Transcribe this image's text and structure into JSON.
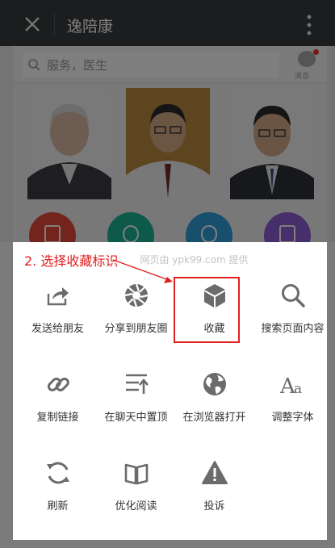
{
  "topbar": {
    "title": "逸陪康"
  },
  "search": {
    "placeholder": "服务，医生",
    "msg_label": "消息"
  },
  "share_sheet": {
    "provided_by": "网页由 ypk99.com 提供",
    "rows": [
      [
        {
          "label": "发送给朋友",
          "icon": "share-icon"
        },
        {
          "label": "分享到朋友圈",
          "icon": "aperture-icon"
        },
        {
          "label": "收藏",
          "icon": "cube-icon"
        },
        {
          "label": "搜索页面内容",
          "icon": "search-icon"
        }
      ],
      [
        {
          "label": "复制链接",
          "icon": "link-icon"
        },
        {
          "label": "在聊天中置顶",
          "icon": "pin-list-icon"
        },
        {
          "label": "在浏览器打开",
          "icon": "globe-icon"
        },
        {
          "label": "调整字体",
          "icon": "font-icon"
        }
      ],
      [
        {
          "label": "刷新",
          "icon": "refresh-icon"
        },
        {
          "label": "优化阅读",
          "icon": "book-icon"
        },
        {
          "label": "投诉",
          "icon": "warning-icon"
        }
      ]
    ]
  },
  "annotation": {
    "text": "2. 选择收藏标识",
    "color": "#e02020"
  },
  "colors": {
    "topbar": "#393a3f",
    "icon": "#6b6b6b",
    "cat_red": "#e64a3b",
    "cat_teal": "#1ab394",
    "cat_blue": "#2e9fd8",
    "cat_purple": "#8e5fd6"
  }
}
